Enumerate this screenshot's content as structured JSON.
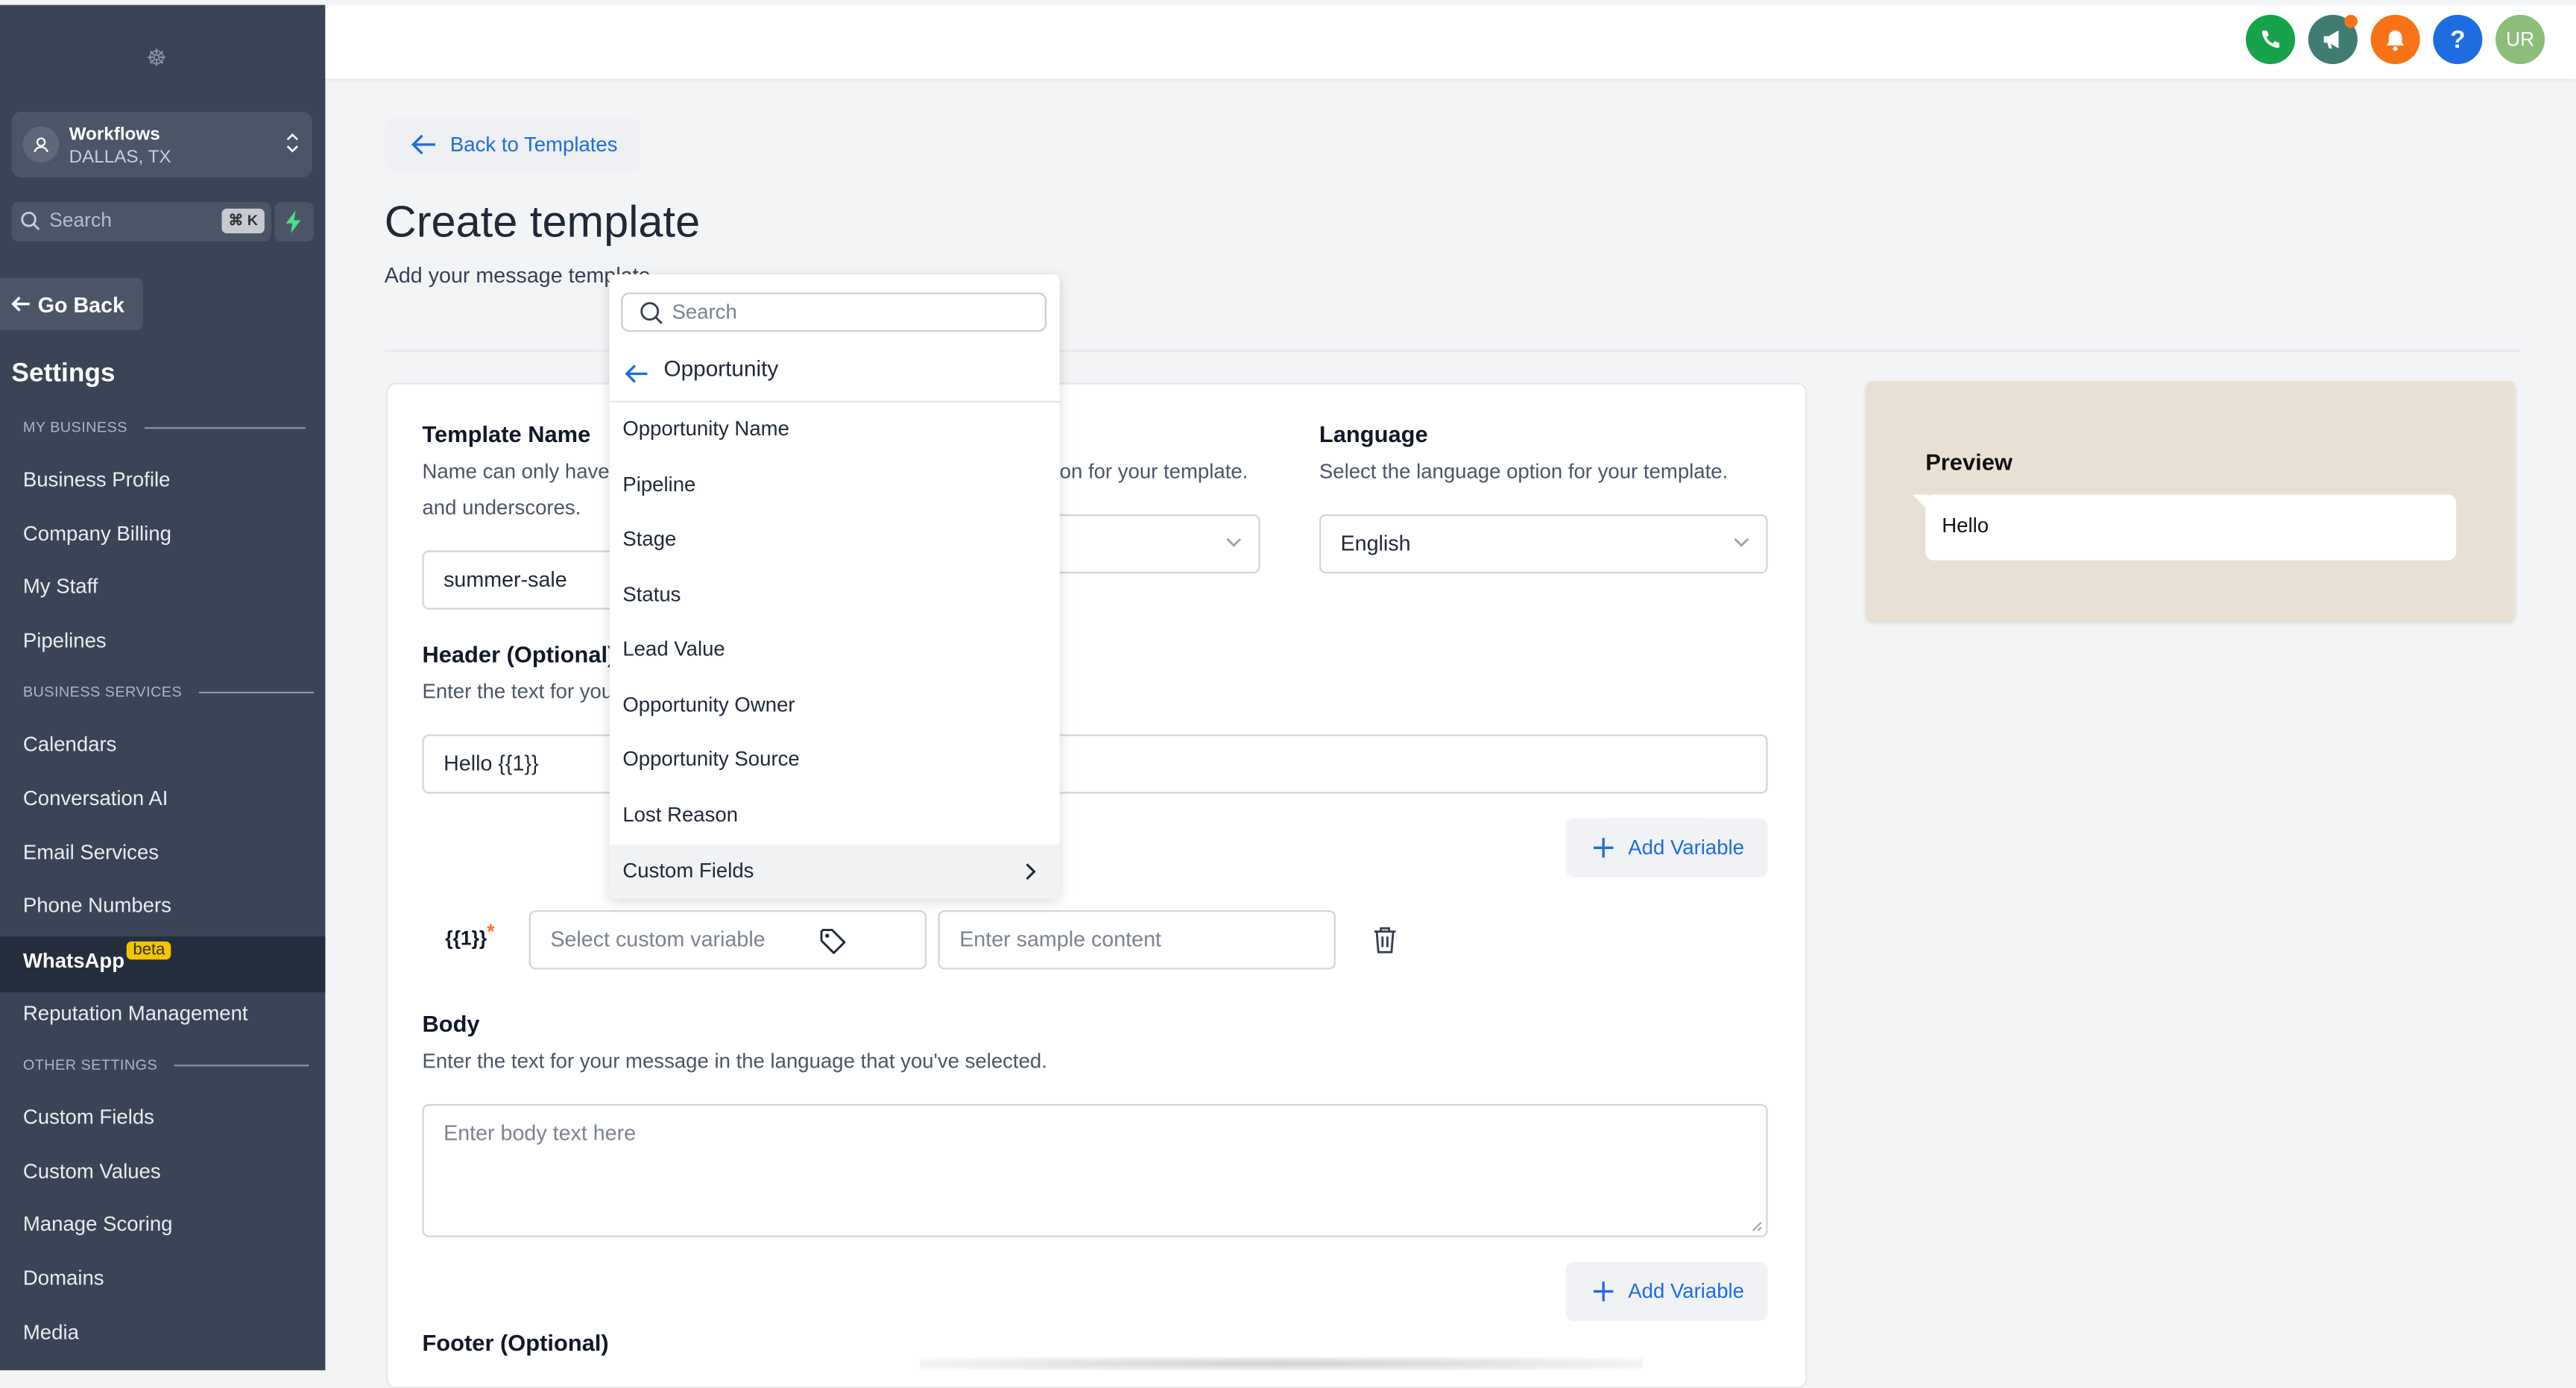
{
  "sidebar": {
    "logo_glyph": "☸",
    "location": {
      "name": "Workflows",
      "sub": "DALLAS, TX"
    },
    "search": {
      "placeholder": "Search",
      "shortcut": "⌘ K"
    },
    "go_back": "Go Back",
    "settings_title": "Settings",
    "sections": [
      {
        "label": "MY BUSINESS"
      },
      {
        "label": "BUSINESS SERVICES"
      },
      {
        "label": "OTHER SETTINGS"
      }
    ],
    "items": [
      {
        "label": "Business Profile"
      },
      {
        "label": "Company Billing"
      },
      {
        "label": "My Staff"
      },
      {
        "label": "Pipelines"
      },
      {
        "label": "Calendars"
      },
      {
        "label": "Conversation AI"
      },
      {
        "label": "Email Services"
      },
      {
        "label": "Phone Numbers"
      },
      {
        "label": "WhatsApp",
        "badge": "beta",
        "active": true
      },
      {
        "label": "Reputation Management"
      },
      {
        "label": "Custom Fields"
      },
      {
        "label": "Custom Values"
      },
      {
        "label": "Manage Scoring"
      },
      {
        "label": "Domains"
      },
      {
        "label": "Media"
      }
    ]
  },
  "topbar": {
    "avatar_initials": "UR",
    "help_glyph": "?",
    "colors": {
      "phone": "#16a34a",
      "megaphone": "#3f7d72",
      "bell": "#f97316",
      "help": "#1d6ce0",
      "avatar": "#8bbf7a"
    }
  },
  "main": {
    "back_label": "Back to Templates",
    "title": "Create template",
    "subtitle": "Add your message template",
    "template_name": {
      "label": "Template Name",
      "help_line1": "Name can only have",
      "help_line2": "and underscores.",
      "value": "summer-sale"
    },
    "category": {
      "help_tail": "on for your template."
    },
    "language": {
      "label": "Language",
      "help": "Select the language option for your template.",
      "value": "English"
    },
    "header": {
      "label": "Header (Optional)",
      "help": "Enter the text for you",
      "value": "Hello {{1}}",
      "add_variable": "Add Variable"
    },
    "variable_row": {
      "token": "{{1}}",
      "required_mark": "*",
      "select_placeholder": "Select custom variable",
      "sample_placeholder": "Enter sample content"
    },
    "body": {
      "label": "Body",
      "help": "Enter the text for your message in the language that you've selected.",
      "placeholder": "Enter body text here",
      "add_variable": "Add Variable"
    },
    "footer": {
      "label": "Footer (Optional)"
    }
  },
  "preview": {
    "title": "Preview",
    "message": "Hello"
  },
  "dropdown": {
    "search_placeholder": "Search",
    "group": "Opportunity",
    "items": [
      {
        "label": "Opportunity Name"
      },
      {
        "label": "Pipeline"
      },
      {
        "label": "Stage"
      },
      {
        "label": "Status"
      },
      {
        "label": "Lead Value"
      },
      {
        "label": "Opportunity Owner"
      },
      {
        "label": "Opportunity Source"
      },
      {
        "label": "Lost Reason"
      },
      {
        "label": "Custom Fields",
        "submenu": true,
        "highlighted": true
      }
    ]
  },
  "accent_color": "#1d6ce0"
}
